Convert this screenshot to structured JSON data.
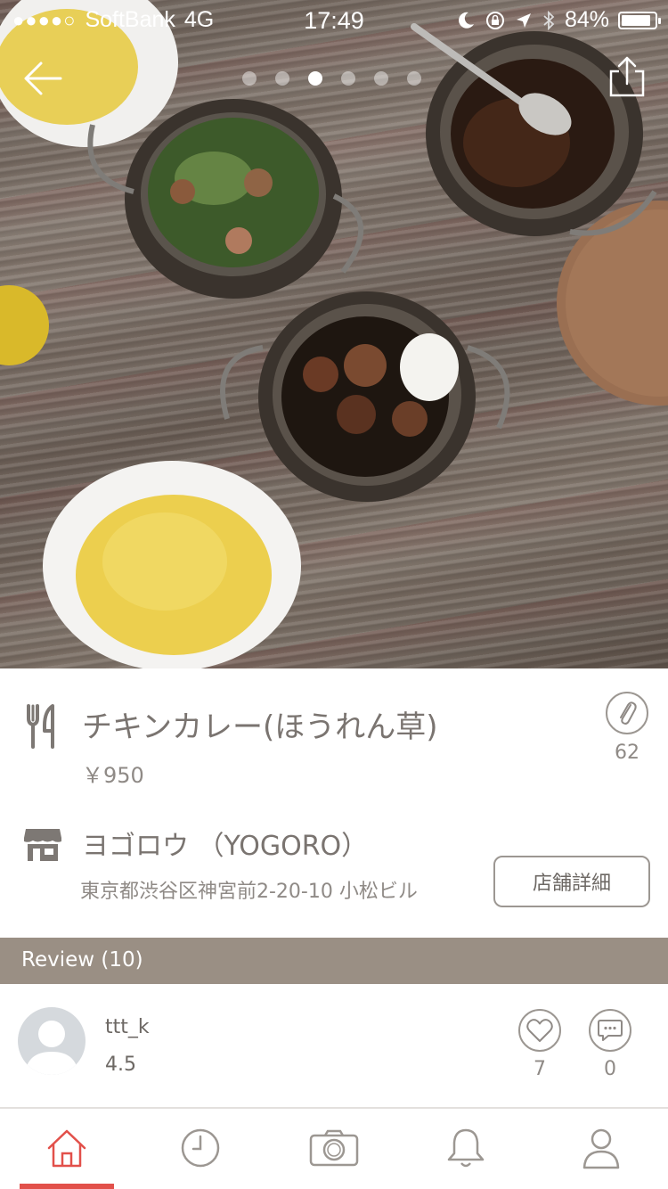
{
  "status_bar": {
    "signal": "●●●●○",
    "carrier": "SoftBank",
    "network": "4G",
    "time": "17:49",
    "battery": "84%"
  },
  "photo": {
    "page_count": 6,
    "active_page": 3
  },
  "dish": {
    "name": "チキンカレー(ほうれん草)",
    "price": "￥950",
    "clip_count": "62"
  },
  "shop": {
    "name": "ヨゴロウ （YOGORO）",
    "address": "東京都渋谷区神宮前2-20-10 小松ビル",
    "detail_button": "店舗詳細"
  },
  "review_section": {
    "title": "Review (10)"
  },
  "review": {
    "user": "ttt_k",
    "score": "4.5",
    "like_count": "7",
    "comment_count": "0"
  },
  "tabbar": {
    "active_tab": "home",
    "accent_color": "#e2504a",
    "icon_color": "#9c9792"
  },
  "icons": {
    "back": "arrow-left-icon",
    "share": "share-icon",
    "dish": "fork-knife-icon",
    "shop": "storefront-icon",
    "clip": "paperclip-icon",
    "like": "heart-icon",
    "comment": "speech-bubble-icon",
    "home": "home-icon",
    "history": "clock-icon",
    "camera": "camera-icon",
    "notifications": "bell-icon",
    "profile": "person-icon"
  }
}
